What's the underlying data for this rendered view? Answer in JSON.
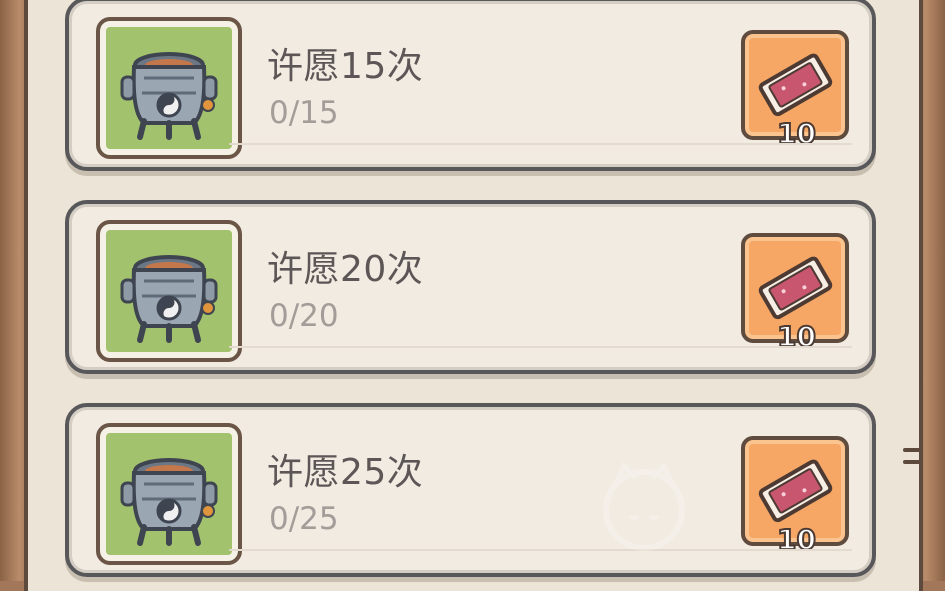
{
  "wish_tasks": [
    {
      "title": "许愿15次",
      "progress": "0/15",
      "progress_value": 0,
      "goal": 15,
      "reward_count": "10"
    },
    {
      "title": "许愿20次",
      "progress": "0/20",
      "progress_value": 0,
      "goal": 20,
      "reward_count": "10"
    },
    {
      "title": "许愿25次",
      "progress": "0/25",
      "progress_value": 0,
      "goal": 25,
      "reward_count": "10"
    }
  ],
  "icons": {
    "task_icon": "cauldron-icon",
    "reward_icon": "ticket-icon"
  },
  "colors": {
    "icon_bg": "#a3c26d",
    "reward_bg": "#f6a765",
    "card_bg": "#f1ebe2",
    "title_text": "#5c5756",
    "progress_text": "#a39d99"
  }
}
